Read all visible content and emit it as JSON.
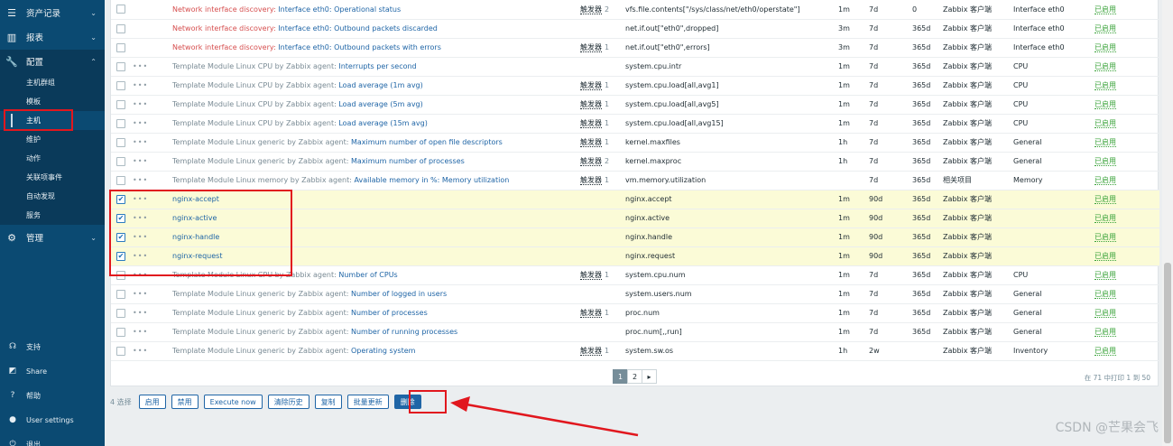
{
  "sidebar": {
    "sections": [
      {
        "label": "资产记录",
        "icon": "list-icon"
      },
      {
        "label": "报表",
        "icon": "chart-icon"
      },
      {
        "label": "配置",
        "icon": "wrench-icon"
      },
      {
        "label": "管理",
        "icon": "gear-icon"
      }
    ],
    "config_items": [
      "主机群组",
      "模板",
      "主机",
      "维护",
      "动作",
      "关联项事件",
      "自动发现",
      "服务"
    ],
    "footer": [
      {
        "label": "支持",
        "icon": "headset-icon"
      },
      {
        "label": "Share",
        "icon": "share-icon"
      },
      {
        "label": "帮助",
        "icon": "help-icon"
      },
      {
        "label": "User settings",
        "icon": "user-icon"
      },
      {
        "label": "退出",
        "icon": "power-icon"
      }
    ]
  },
  "table": {
    "rows": [
      {
        "checked": false,
        "dots": false,
        "tpl": "Network interface discovery",
        "tpl_class": "red",
        "name": "Interface eth0: Operational status",
        "trig": "触发器",
        "trig_n": "2",
        "key": "vfs.file.contents[\"/sys/class/net/eth0/operstate\"]",
        "interval": "1m",
        "history": "7d",
        "trends": "0",
        "type": "Zabbix 客户端",
        "app": "Interface eth0",
        "status": "已启用"
      },
      {
        "checked": false,
        "dots": false,
        "tpl": "Network interface discovery",
        "tpl_class": "red",
        "name": "Interface eth0: Outbound packets discarded",
        "trig": "",
        "trig_n": "",
        "key": "net.if.out[\"eth0\",dropped]",
        "interval": "3m",
        "history": "7d",
        "trends": "365d",
        "type": "Zabbix 客户端",
        "app": "Interface eth0",
        "status": "已启用"
      },
      {
        "checked": false,
        "dots": false,
        "tpl": "Network interface discovery",
        "tpl_class": "red",
        "name": "Interface eth0: Outbound packets with errors",
        "trig": "触发器",
        "trig_n": "1",
        "key": "net.if.out[\"eth0\",errors]",
        "interval": "3m",
        "history": "7d",
        "trends": "365d",
        "type": "Zabbix 客户端",
        "app": "Interface eth0",
        "status": "已启用"
      },
      {
        "checked": false,
        "dots": true,
        "tpl": "Template Module Linux CPU by Zabbix agent",
        "tpl_class": "tpl",
        "name": "Interrupts per second",
        "trig": "",
        "trig_n": "",
        "key": "system.cpu.intr",
        "interval": "1m",
        "history": "7d",
        "trends": "365d",
        "type": "Zabbix 客户端",
        "app": "CPU",
        "status": "已启用"
      },
      {
        "checked": false,
        "dots": true,
        "tpl": "Template Module Linux CPU by Zabbix agent",
        "tpl_class": "tpl",
        "name": "Load average (1m avg)",
        "trig": "触发器",
        "trig_n": "1",
        "key": "system.cpu.load[all,avg1]",
        "interval": "1m",
        "history": "7d",
        "trends": "365d",
        "type": "Zabbix 客户端",
        "app": "CPU",
        "status": "已启用"
      },
      {
        "checked": false,
        "dots": true,
        "tpl": "Template Module Linux CPU by Zabbix agent",
        "tpl_class": "tpl",
        "name": "Load average (5m avg)",
        "trig": "触发器",
        "trig_n": "1",
        "key": "system.cpu.load[all,avg5]",
        "interval": "1m",
        "history": "7d",
        "trends": "365d",
        "type": "Zabbix 客户端",
        "app": "CPU",
        "status": "已启用"
      },
      {
        "checked": false,
        "dots": true,
        "tpl": "Template Module Linux CPU by Zabbix agent",
        "tpl_class": "tpl",
        "name": "Load average (15m avg)",
        "trig": "触发器",
        "trig_n": "1",
        "key": "system.cpu.load[all,avg15]",
        "interval": "1m",
        "history": "7d",
        "trends": "365d",
        "type": "Zabbix 客户端",
        "app": "CPU",
        "status": "已启用"
      },
      {
        "checked": false,
        "dots": true,
        "tpl": "Template Module Linux generic by Zabbix agent",
        "tpl_class": "tpl",
        "name": "Maximum number of open file descriptors",
        "trig": "触发器",
        "trig_n": "1",
        "key": "kernel.maxfiles",
        "interval": "1h",
        "history": "7d",
        "trends": "365d",
        "type": "Zabbix 客户端",
        "app": "General",
        "status": "已启用"
      },
      {
        "checked": false,
        "dots": true,
        "tpl": "Template Module Linux generic by Zabbix agent",
        "tpl_class": "tpl",
        "name": "Maximum number of processes",
        "trig": "触发器",
        "trig_n": "2",
        "key": "kernel.maxproc",
        "interval": "1h",
        "history": "7d",
        "trends": "365d",
        "type": "Zabbix 客户端",
        "app": "General",
        "status": "已启用"
      },
      {
        "checked": false,
        "dots": true,
        "tpl": "Template Module Linux memory by Zabbix agent",
        "tpl_class": "tpl",
        "name": "Available memory in %: Memory utilization",
        "trig": "触发器",
        "trig_n": "1",
        "key": "vm.memory.utilization",
        "interval": "",
        "history": "7d",
        "trends": "365d",
        "type": "相关项目",
        "app": "Memory",
        "status": "已启用"
      },
      {
        "checked": true,
        "dots": true,
        "tpl": "",
        "tpl_class": "",
        "name": "nginx-accept",
        "trig": "",
        "trig_n": "",
        "key": "nginx.accept",
        "interval": "1m",
        "history": "90d",
        "trends": "365d",
        "type": "Zabbix 客户端",
        "app": "",
        "status": "已启用"
      },
      {
        "checked": true,
        "dots": true,
        "tpl": "",
        "tpl_class": "",
        "name": "nginx-active",
        "trig": "",
        "trig_n": "",
        "key": "nginx.active",
        "interval": "1m",
        "history": "90d",
        "trends": "365d",
        "type": "Zabbix 客户端",
        "app": "",
        "status": "已启用"
      },
      {
        "checked": true,
        "dots": true,
        "tpl": "",
        "tpl_class": "",
        "name": "nginx-handle",
        "trig": "",
        "trig_n": "",
        "key": "nginx.handle",
        "interval": "1m",
        "history": "90d",
        "trends": "365d",
        "type": "Zabbix 客户端",
        "app": "",
        "status": "已启用"
      },
      {
        "checked": true,
        "dots": true,
        "tpl": "",
        "tpl_class": "",
        "name": "nginx-request",
        "trig": "",
        "trig_n": "",
        "key": "nginx.request",
        "interval": "1m",
        "history": "90d",
        "trends": "365d",
        "type": "Zabbix 客户端",
        "app": "",
        "status": "已启用"
      },
      {
        "checked": false,
        "dots": true,
        "tpl": "Template Module Linux CPU by Zabbix agent",
        "tpl_class": "tpl",
        "name": "Number of CPUs",
        "trig": "触发器",
        "trig_n": "1",
        "key": "system.cpu.num",
        "interval": "1m",
        "history": "7d",
        "trends": "365d",
        "type": "Zabbix 客户端",
        "app": "CPU",
        "status": "已启用"
      },
      {
        "checked": false,
        "dots": true,
        "tpl": "Template Module Linux generic by Zabbix agent",
        "tpl_class": "tpl",
        "name": "Number of logged in users",
        "trig": "",
        "trig_n": "",
        "key": "system.users.num",
        "interval": "1m",
        "history": "7d",
        "trends": "365d",
        "type": "Zabbix 客户端",
        "app": "General",
        "status": "已启用"
      },
      {
        "checked": false,
        "dots": true,
        "tpl": "Template Module Linux generic by Zabbix agent",
        "tpl_class": "tpl",
        "name": "Number of processes",
        "trig": "触发器",
        "trig_n": "1",
        "key": "proc.num",
        "interval": "1m",
        "history": "7d",
        "trends": "365d",
        "type": "Zabbix 客户端",
        "app": "General",
        "status": "已启用"
      },
      {
        "checked": false,
        "dots": true,
        "tpl": "Template Module Linux generic by Zabbix agent",
        "tpl_class": "tpl",
        "name": "Number of running processes",
        "trig": "",
        "trig_n": "",
        "key": "proc.num[,,run]",
        "interval": "1m",
        "history": "7d",
        "trends": "365d",
        "type": "Zabbix 客户端",
        "app": "General",
        "status": "已启用"
      },
      {
        "checked": false,
        "dots": true,
        "tpl": "Template Module Linux generic by Zabbix agent",
        "tpl_class": "tpl",
        "name": "Operating system",
        "trig": "触发器",
        "trig_n": "1",
        "key": "system.sw.os",
        "interval": "1h",
        "history": "2w",
        "trends": "",
        "type": "Zabbix 客户端",
        "app": "Inventory",
        "status": "已启用"
      }
    ]
  },
  "pager": {
    "pages": [
      "1",
      "2"
    ],
    "next": "▸",
    "current": "1"
  },
  "shown": "在 71 中打印 1 到 50",
  "actions": {
    "selected": "4 选择",
    "buttons": [
      "启用",
      "禁用",
      "Execute now",
      "清除历史",
      "复制",
      "批量更新",
      "删除"
    ]
  },
  "watermark": "CSDN @芒果会飞",
  "colors": {
    "sidebar": "#0b4a72",
    "link": "#1f65a6",
    "highlight": "#e1171e",
    "selected_row": "#fbfbd7"
  }
}
